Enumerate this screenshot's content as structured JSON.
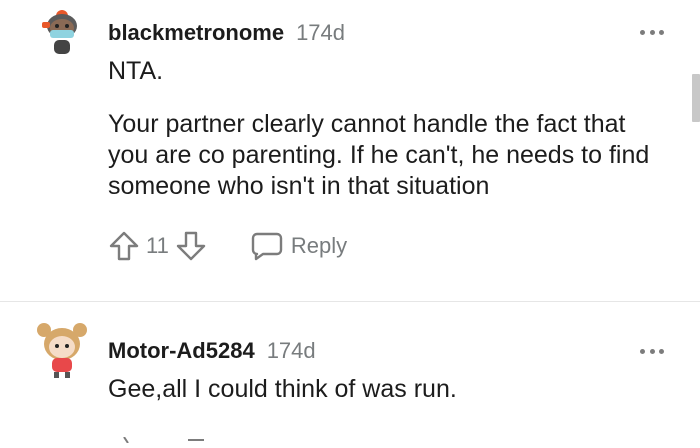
{
  "comments": [
    {
      "username": "blackmetronome",
      "age": "174d",
      "paragraphs": [
        "NTA.",
        "Your partner clearly cannot handle the fact that you are co parenting. If he can't, he needs to find someone who isn't in that situation"
      ],
      "votes": "11",
      "reply_label": "Reply",
      "avatar_icon": "snoo-avatar-mask-icon"
    },
    {
      "username": "Motor-Ad5284",
      "age": "174d",
      "paragraphs": [
        "Gee,all I could think of was run."
      ],
      "avatar_icon": "snoo-avatar-girl-icon"
    }
  ],
  "colors": {
    "text": "#1c1c1c",
    "meta": "#787c7e",
    "divider": "#e6e6e6"
  }
}
